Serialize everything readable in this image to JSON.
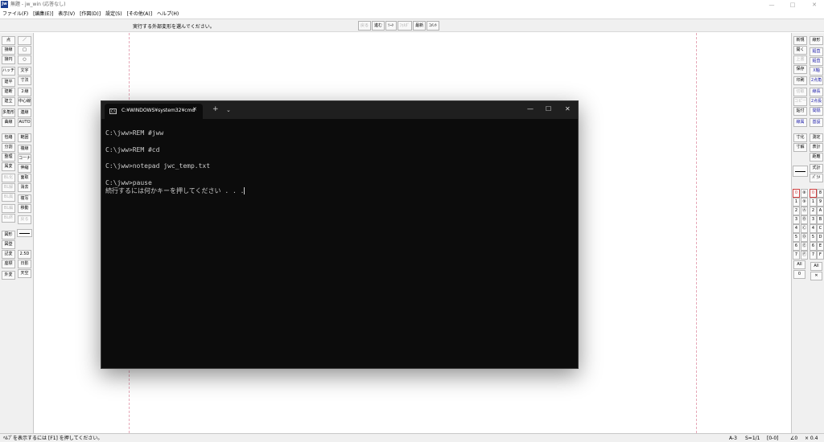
{
  "window": {
    "title": "無題 - jw_win (応答なし)",
    "app_icon": "Jw"
  },
  "title_controls": {
    "minimize": "—",
    "maximize": "□",
    "close": "✕"
  },
  "menu": [
    "ファイル(F)",
    "[編集(E)]",
    "表示(V)",
    "[作図(D)]",
    "設定(S)",
    "[その他(A)]",
    "ヘルプ(H)"
  ],
  "prompt": {
    "text": "実行する外部変形を選んでください。",
    "buttons": [
      "戻る",
      "進む",
      "ｿｰﾄ",
      "ﾌｫﾙﾀﾞ",
      "最新",
      "ｺﾒﾝﾄ"
    ]
  },
  "left_toolbar": {
    "col1": [
      "点",
      "接線",
      "接円",
      "ハッチ",
      "建平",
      "建断",
      "建立",
      "多角形",
      "曲線",
      "包絡",
      "分割",
      "整理",
      "属変",
      "BL化",
      "BL解",
      "BL属",
      "BL編",
      "BL終",
      "図形",
      "図登",
      "記変",
      "座標",
      "外変"
    ],
    "col2": [
      "／",
      "□",
      "○",
      "文字",
      "寸法",
      "２線",
      "中心線",
      "連線",
      "AUTO",
      "範囲",
      "複線",
      "コーナー",
      "伸縮",
      "面取",
      "消去",
      "複写",
      "移動",
      "戻る",
      "2.5D",
      "日影",
      "天空"
    ]
  },
  "right_toolbar": {
    "col1": [
      "新規",
      "開く",
      "上書",
      "保存",
      "印刷",
      "切取",
      "コピー",
      "貼付",
      "線属",
      "寸化",
      "寸解",
      "",
      "All",
      "0"
    ],
    "col2": [
      "線形",
      "鉛直",
      "鉛直",
      "X軸",
      "2点角",
      "線長",
      "2点長",
      "間隔",
      "基設",
      "測定",
      "表計",
      "距離",
      "式計",
      "ﾊﾟﾗﾒ",
      "All",
      "✕"
    ],
    "layer_group": [
      "0",
      "1",
      "2",
      "3",
      "4",
      "5",
      "6",
      "7"
    ],
    "layer_circled": [
      "⑧",
      "⑨",
      "Ⓐ",
      "Ⓑ",
      "Ⓒ",
      "Ⓓ",
      "Ⓔ",
      "Ⓕ"
    ],
    "layer_right": [
      "0",
      "1",
      "2",
      "3",
      "4",
      "5",
      "6",
      "7"
    ],
    "layer_right2": [
      "8",
      "9",
      "A",
      "B",
      "C",
      "D",
      "E",
      "F"
    ]
  },
  "status": {
    "help": "ﾍﾙﾌﾟを表示するには [F1] を押してください。",
    "paper": "A-3",
    "scale": "S=1/1",
    "layer": "[0-0]",
    "angle": "∠0",
    "zoom": "× 0.4"
  },
  "cmd": {
    "tab_title": "C:¥WINDOWS¥system32¥cmd",
    "tab_icon": "C:\\",
    "new_tab": "+",
    "dropdown": "⌄",
    "controls": {
      "minimize": "—",
      "maximize": "☐",
      "close": "✕"
    },
    "lines": [
      "C:\\jww>REM #jww",
      "",
      "C:\\jww>REM #cd",
      "",
      "C:\\jww>notepad jwc_temp.txt",
      "",
      "C:\\jww>pause",
      "続行するには何かキーを押してください . . ."
    ]
  }
}
